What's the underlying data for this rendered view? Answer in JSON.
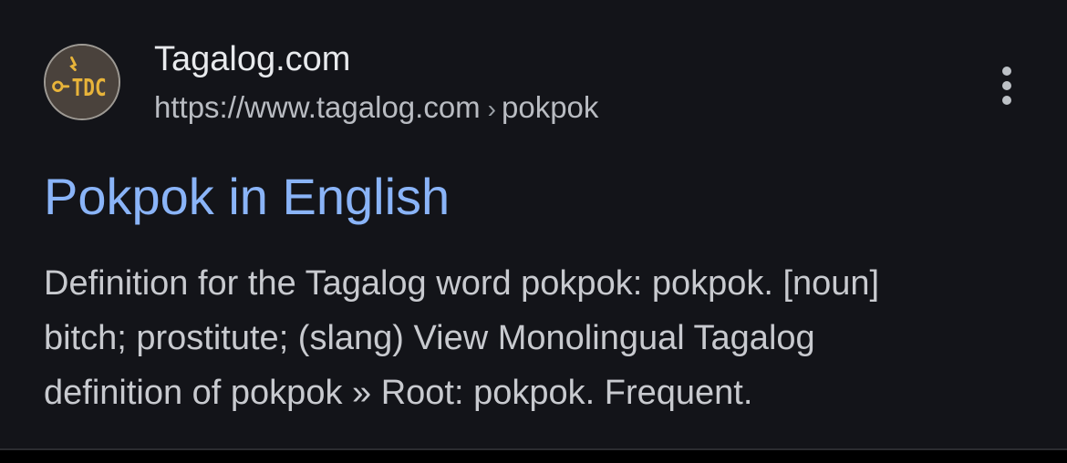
{
  "result": {
    "site_name": "Tagalog.com",
    "url": "https://www.tagalog.com",
    "breadcrumb_separator": "›",
    "breadcrumb_path": "pokpok",
    "favicon": {
      "icon": "tdc-logo-icon",
      "letters": "TDC",
      "background": "#4a423c",
      "letter_color": "#e8b43a"
    },
    "title": "Pokpok in English",
    "snippet_lines": [
      "Definition for the Tagalog word pokpok: pokpok. [noun]",
      "bitch; prostitute; (slang) View Monolingual Tagalog",
      "definition of pokpok » Root: pokpok. Frequent."
    ],
    "menu_icon": "more-vert-icon"
  },
  "colors": {
    "background": "#131419",
    "title_link": "#8ab4f8",
    "site_name": "#e8eaed",
    "url": "#b9bcc2",
    "snippet": "#c8cacf"
  }
}
